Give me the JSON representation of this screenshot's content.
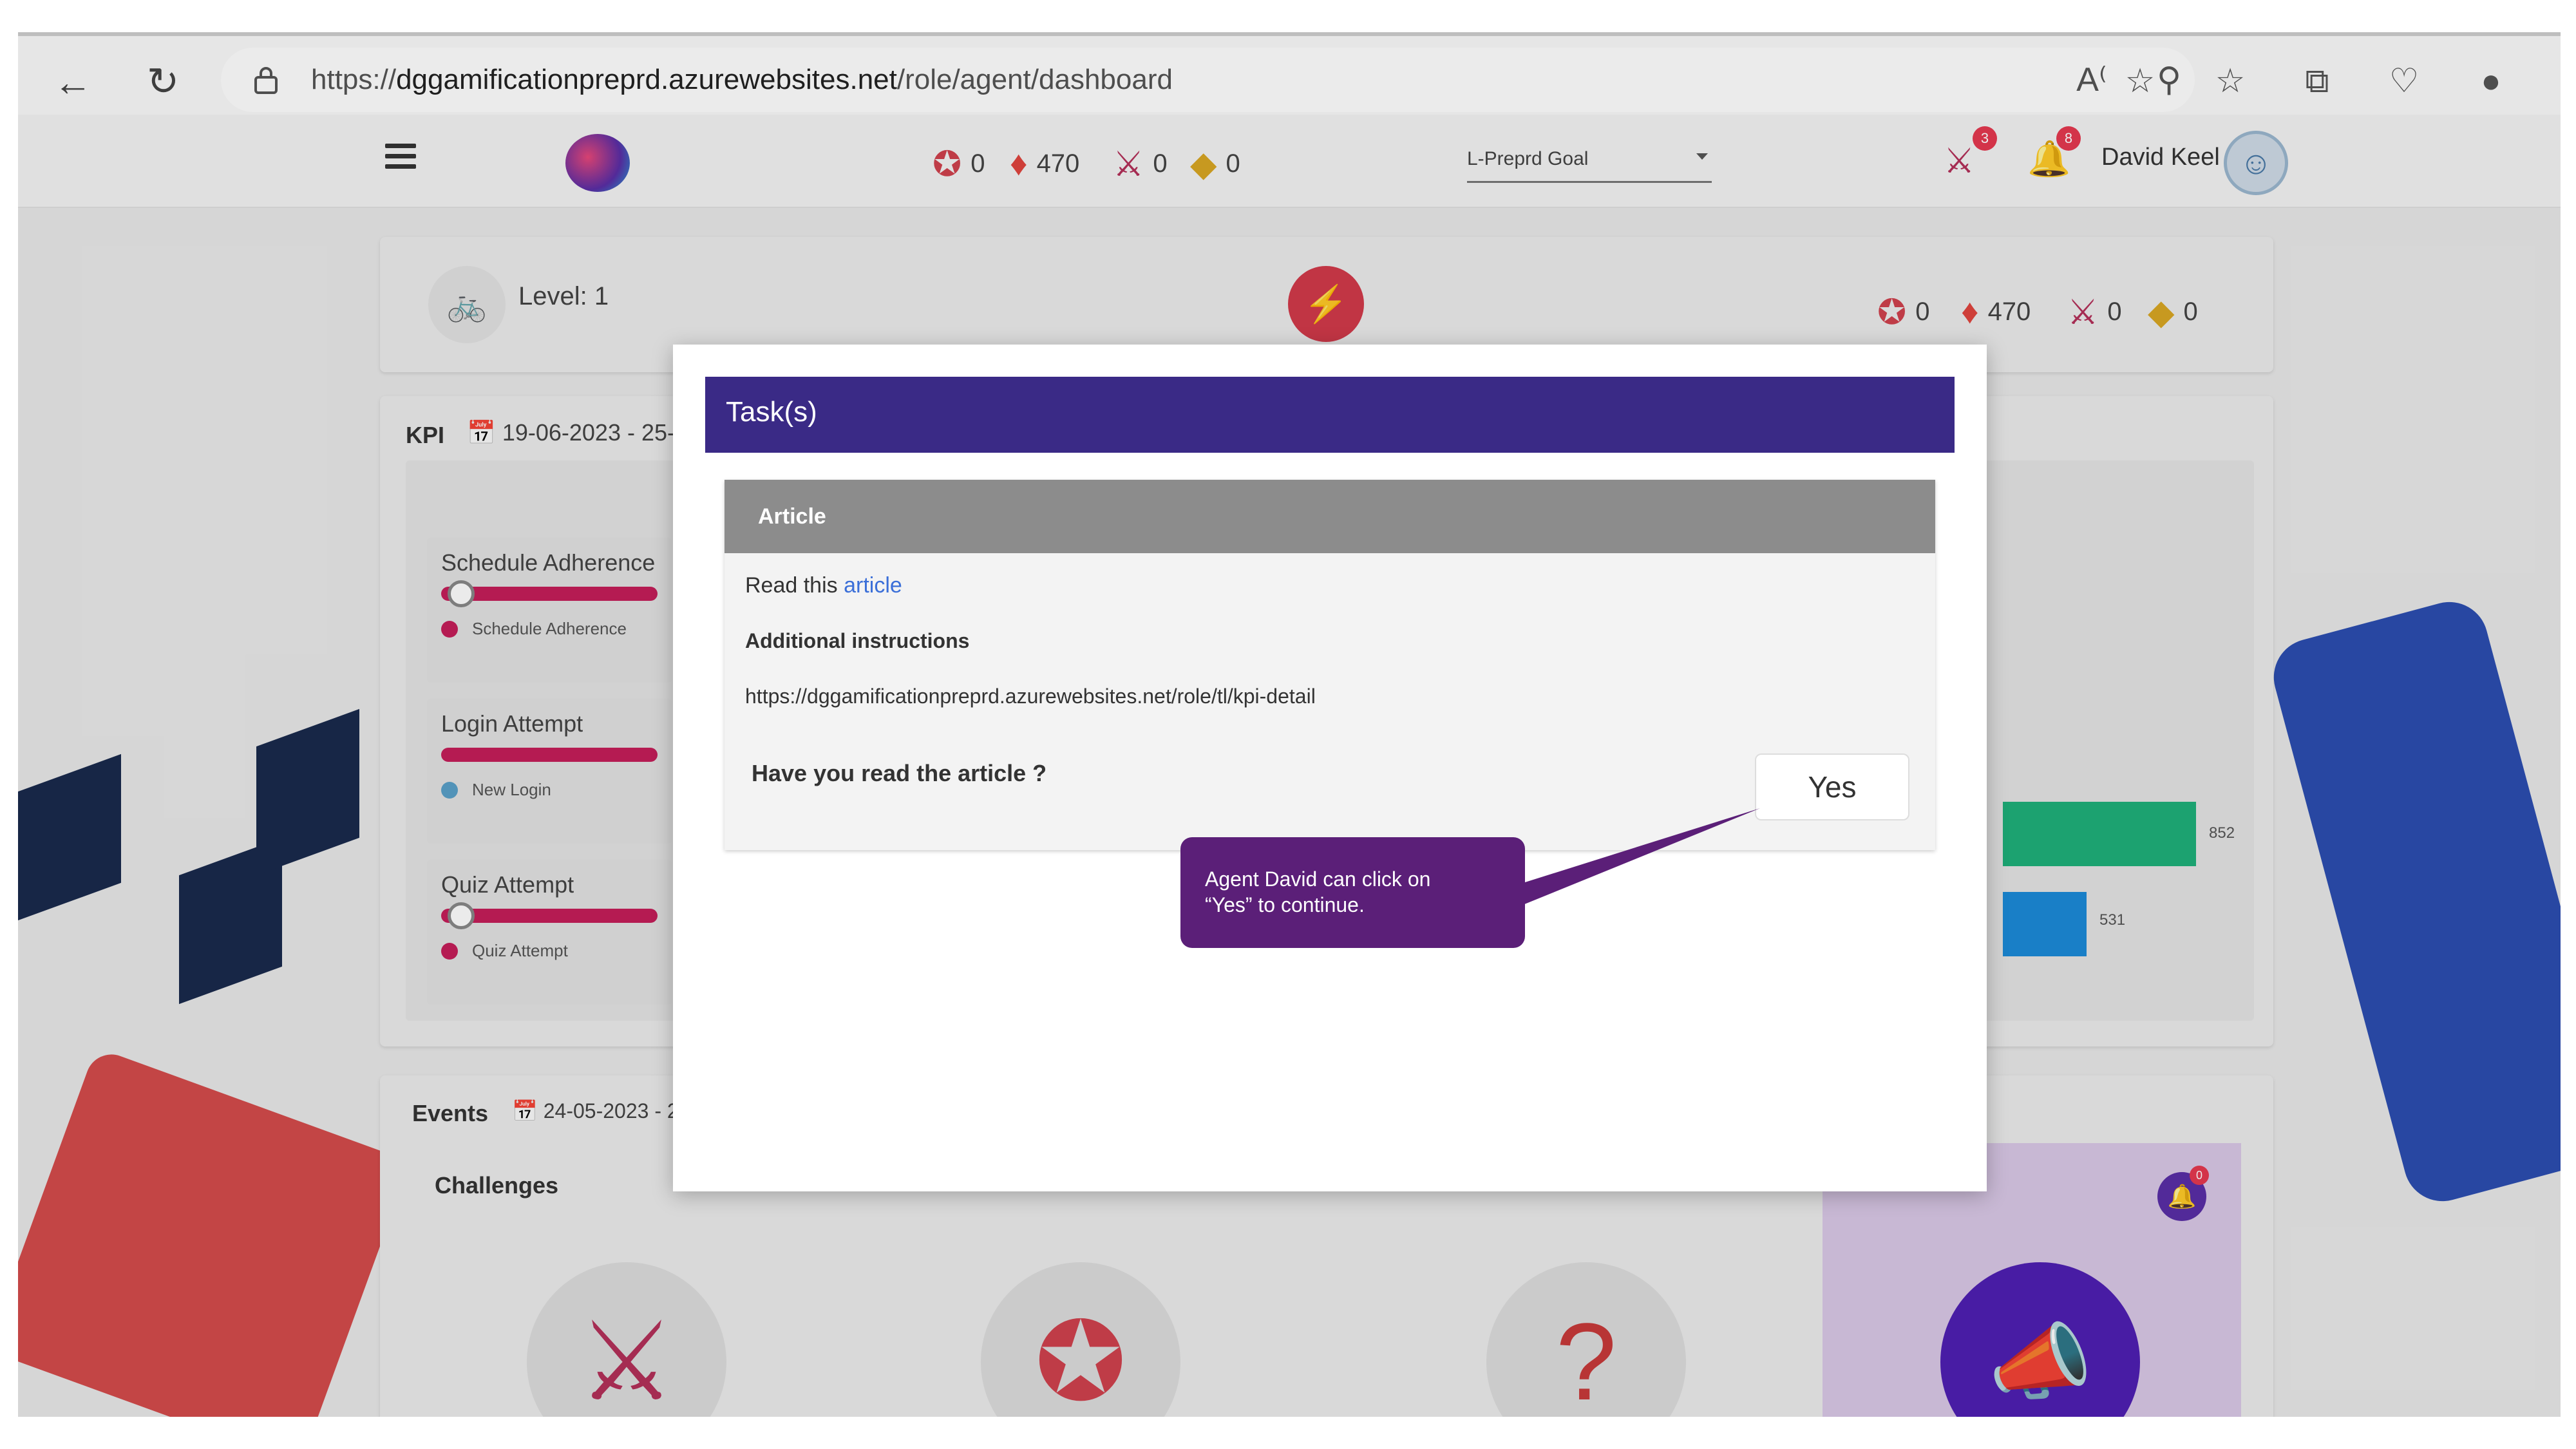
{
  "browser": {
    "url_prefix": "https://",
    "url_domain": "dggamificationpreprd.azurewebsites.net",
    "url_path": "/role/agent/dashboard"
  },
  "header": {
    "stats": [
      {
        "icon": "medal-icon",
        "value": "0"
      },
      {
        "icon": "gem-icon",
        "value": "470"
      },
      {
        "icon": "sword-icon",
        "value": "0"
      },
      {
        "icon": "ticket-icon",
        "value": "0"
      }
    ],
    "goal_select": "L-Preprd Goal",
    "sword_badge": "3",
    "bell_badge": "8",
    "user_name": "David Keel"
  },
  "level_card": {
    "level_label": "Level: 1",
    "stats": [
      {
        "icon": "medal-icon",
        "value": "0"
      },
      {
        "icon": "gem-icon",
        "value": "470"
      },
      {
        "icon": "sword-icon",
        "value": "0"
      },
      {
        "icon": "ticket-icon",
        "value": "0"
      }
    ]
  },
  "kpi": {
    "label": "KPI",
    "date_range": "19-06-2023 - 25-",
    "rows": [
      {
        "title": "Schedule Adherence",
        "legend": "Schedule Adherence",
        "color": "#c51e5a"
      },
      {
        "title": "Login Attempt",
        "legend": "New Login",
        "color": "#5aa0c8"
      },
      {
        "title": "Quiz Attempt",
        "legend": "Quiz Attempt",
        "color": "#c51e5a"
      }
    ],
    "bar_values": [
      "852",
      "531"
    ]
  },
  "events": {
    "label": "Events",
    "date_range": "24-05-2023 - 2",
    "challenges_label": "Challenges",
    "bell_badge": "0"
  },
  "modal": {
    "title": "Task(s)",
    "card_title": "Article",
    "read_prefix": "Read this",
    "read_link": "article",
    "instructions_label": "Additional instructions",
    "instructions_url": "https://dggamificationpreprd.azurewebsites.net/role/tl/kpi-detail",
    "question": "Have you read the article ?",
    "yes_label": "Yes"
  },
  "callout": {
    "line1": "Agent David can  click on",
    "line2": "“Yes” to continue."
  },
  "colors": {
    "modal_header": "#3a2a86",
    "callout": "#5b1f78",
    "link": "#3b6fd8"
  }
}
